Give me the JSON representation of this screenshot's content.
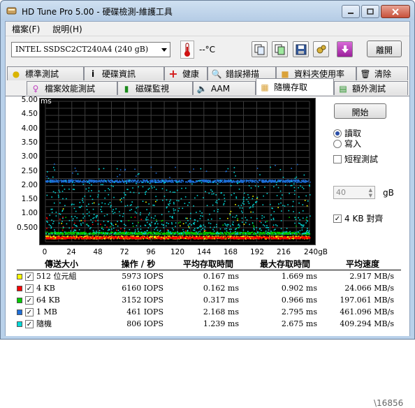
{
  "window": {
    "title": "HD Tune Pro  5.00 - 硬碟檢測-維護工具"
  },
  "menu": [
    "檔案(F)",
    "說明(H)"
  ],
  "toolbar": {
    "drive": "INTEL SSDSC2CT240A4      (240 gB)",
    "temperature": "--°C",
    "exit_label": "離開"
  },
  "tabs_row1": [
    "標準測試",
    "硬碟資訊",
    "健康",
    "錯誤掃描",
    "資料夾使用率",
    "清除"
  ],
  "tabs_row2": [
    "檔案效能測試",
    "磁碟監視",
    "AAM",
    "隨機存取",
    "額外測試"
  ],
  "active_tab": "隨機存取",
  "side": {
    "start_label": "開始",
    "read_label": "讀取",
    "write_label": "寫入",
    "short_label": "短程測試",
    "short_value": "40",
    "unit": "gB",
    "align_label": "4 KB 對齊",
    "mode": "read",
    "short_checked": false,
    "align_checked": true
  },
  "chart_data": {
    "type": "scatter",
    "ylabel": "ms",
    "xlabel": "gB",
    "xlim": [
      0,
      240
    ],
    "ylim": [
      0,
      5.0
    ],
    "yticks": [
      "5.00",
      "4.50",
      "4.00",
      "3.50",
      "3.00",
      "2.50",
      "2.00",
      "1.50",
      "1.00",
      "0.500"
    ],
    "xticks": [
      "0",
      "24",
      "48",
      "72",
      "96",
      "120",
      "144",
      "168",
      "192",
      "216",
      "240gB"
    ],
    "grid": true,
    "series": [
      {
        "name": "512 位元組",
        "color": "#ffff00",
        "band": [
          0.12,
          0.22
        ],
        "sparse": [
          0.4,
          1.67
        ]
      },
      {
        "name": "4 KB",
        "color": "#ff0000",
        "band": [
          0.12,
          0.2
        ],
        "sparse": [
          0.4,
          0.9
        ]
      },
      {
        "name": "64 KB",
        "color": "#00cc00",
        "band": [
          0.28,
          0.36
        ],
        "sparse": [
          0.5,
          0.97
        ]
      },
      {
        "name": "1 MB",
        "color": "#1e6ed8",
        "band": [
          2.13,
          2.22
        ],
        "sparse": [
          2.3,
          2.8
        ]
      },
      {
        "name": "隨機",
        "color": "#00d8d8",
        "band": [
          0.3,
          2.2
        ],
        "sparse": [
          2.2,
          2.68
        ]
      }
    ]
  },
  "table": {
    "headers": [
      "傳送大小",
      "操作 / 秒",
      "平均存取時間",
      "最大存取時間",
      "平均速度"
    ],
    "rows": [
      {
        "label": "512 位元組",
        "color": "#ffff00",
        "ops": "5973 IOPS",
        "avg": "0.167 ms",
        "max": "1.669 ms",
        "speed": "2.917 MB/s"
      },
      {
        "label": "4 KB",
        "color": "#ff0000",
        "ops": "6160 IOPS",
        "avg": "0.162 ms",
        "max": "0.902 ms",
        "speed": "24.066 MB/s"
      },
      {
        "label": "64 KB",
        "color": "#00cc00",
        "ops": "3152 IOPS",
        "avg": "0.317 ms",
        "max": "0.966 ms",
        "speed": "197.061 MB/s"
      },
      {
        "label": "1 MB",
        "color": "#1e6ed8",
        "ops": "461 IOPS",
        "avg": "2.168 ms",
        "max": "2.795 ms",
        "speed": "461.096 MB/s"
      },
      {
        "label": "隨機",
        "color": "#00d8d8",
        "ops": "806 IOPS",
        "avg": "1.239 ms",
        "max": "2.675 ms",
        "speed": "409.294 MB/s"
      }
    ]
  },
  "watermark": "\\16856"
}
